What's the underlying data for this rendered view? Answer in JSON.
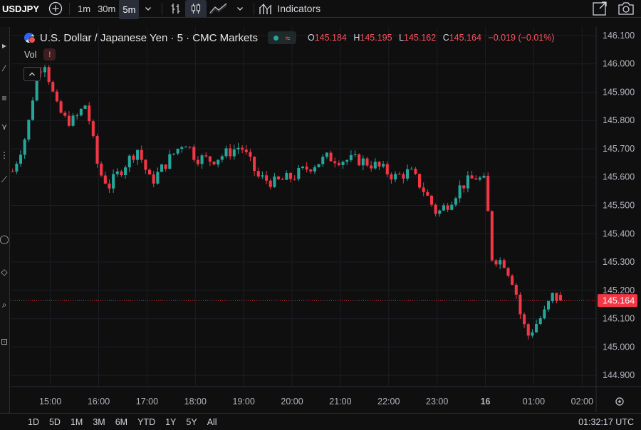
{
  "toolbar": {
    "symbol": "USDJPY",
    "timeframes": [
      "1m",
      "30m",
      "5m"
    ],
    "active_timeframe": "5m",
    "indicators_label": "Indicators",
    "icons": [
      "plus-circle-icon",
      "chevron-down-icon",
      "bar-style-icon",
      "candles-icon",
      "area-chart-icon",
      "indicators-icon",
      "snapshot-icon",
      "camera-icon"
    ]
  },
  "legend": {
    "instrument": "U.S. Dollar / Japanese Yen · 5 · CMC Markets",
    "open_label": "O",
    "open": "145.184",
    "high_label": "H",
    "high": "145.195",
    "low_label": "L",
    "low": "145.162",
    "close_label": "C",
    "close": "145.164",
    "change": "−0.019 (−0.01%)",
    "vol_label": "Vol",
    "warning_glyph": "!"
  },
  "colors": {
    "up": "#26a69a",
    "down": "#f23645",
    "background": "#0f0f0f",
    "last_price": "#f23645"
  },
  "chart_data": {
    "type": "candlestick",
    "instrument": "USDJPY",
    "interval": "5m",
    "ylim": [
      144.86,
      146.13
    ],
    "y_ticks": [
      "146.100",
      "146.000",
      "145.900",
      "145.800",
      "145.700",
      "145.600",
      "145.500",
      "145.400",
      "145.300",
      "145.200",
      "145.100",
      "145.000",
      "144.900"
    ],
    "x_ticks": [
      {
        "label": "15:00",
        "t": 14.96
      },
      {
        "label": "16:00",
        "t": 15.96
      },
      {
        "label": "17:00",
        "t": 16.96
      },
      {
        "label": "18:00",
        "t": 17.96
      },
      {
        "label": "19:00",
        "t": 18.96
      },
      {
        "label": "20:00",
        "t": 19.96
      },
      {
        "label": "21:00",
        "t": 20.96
      },
      {
        "label": "22:00",
        "t": 21.96
      },
      {
        "label": "23:00",
        "t": 22.96
      },
      {
        "label": "16",
        "t": 23.96
      },
      {
        "label": "01:00",
        "t": 24.96
      },
      {
        "label": "02:00",
        "t": 25.96
      }
    ],
    "x_range": [
      14.14,
      26.25
    ],
    "last_price": "145.164",
    "last_price_value": 145.164,
    "key_prices": [
      {
        "t": 14.18,
        "price": 145.62
      },
      {
        "t": 14.48,
        "price": 145.76
      },
      {
        "t": 14.68,
        "price": 145.97
      },
      {
        "t": 14.84,
        "price": 146.01
      },
      {
        "t": 15.08,
        "price": 145.85
      },
      {
        "t": 15.28,
        "price": 145.8
      },
      {
        "t": 15.46,
        "price": 145.8
      },
      {
        "t": 15.7,
        "price": 145.86
      },
      {
        "t": 15.96,
        "price": 145.62
      },
      {
        "t": 16.18,
        "price": 145.57
      },
      {
        "t": 16.48,
        "price": 145.64
      },
      {
        "t": 16.76,
        "price": 145.7
      },
      {
        "t": 17.04,
        "price": 145.58
      },
      {
        "t": 17.4,
        "price": 145.66
      },
      {
        "t": 17.74,
        "price": 145.73
      },
      {
        "t": 17.96,
        "price": 145.67
      },
      {
        "t": 18.3,
        "price": 145.66
      },
      {
        "t": 18.56,
        "price": 145.68
      },
      {
        "t": 18.9,
        "price": 145.71
      },
      {
        "t": 19.26,
        "price": 145.6
      },
      {
        "t": 19.6,
        "price": 145.58
      },
      {
        "t": 19.96,
        "price": 145.6
      },
      {
        "t": 20.36,
        "price": 145.64
      },
      {
        "t": 20.7,
        "price": 145.67
      },
      {
        "t": 21.06,
        "price": 145.66
      },
      {
        "t": 21.36,
        "price": 145.66
      },
      {
        "t": 21.7,
        "price": 145.64
      },
      {
        "t": 22.1,
        "price": 145.6
      },
      {
        "t": 22.4,
        "price": 145.62
      },
      {
        "t": 22.66,
        "price": 145.56
      },
      {
        "t": 22.96,
        "price": 145.47
      },
      {
        "t": 23.2,
        "price": 145.51
      },
      {
        "t": 23.46,
        "price": 145.57
      },
      {
        "t": 23.76,
        "price": 145.6
      },
      {
        "t": 23.98,
        "price": 145.58
      },
      {
        "t": 24.06,
        "price": 145.32
      },
      {
        "t": 24.34,
        "price": 145.3
      },
      {
        "t": 24.56,
        "price": 145.22
      },
      {
        "t": 24.7,
        "price": 145.1
      },
      {
        "t": 24.84,
        "price": 145.04
      },
      {
        "t": 25.0,
        "price": 145.08
      },
      {
        "t": 25.18,
        "price": 145.12
      },
      {
        "t": 25.34,
        "price": 145.18
      },
      {
        "t": 25.52,
        "price": 145.164
      }
    ]
  },
  "bottom": {
    "ranges": [
      "1D",
      "5D",
      "1M",
      "3M",
      "6M",
      "YTD",
      "1Y",
      "5Y",
      "All"
    ],
    "clock": "01:32:17 UTC"
  }
}
